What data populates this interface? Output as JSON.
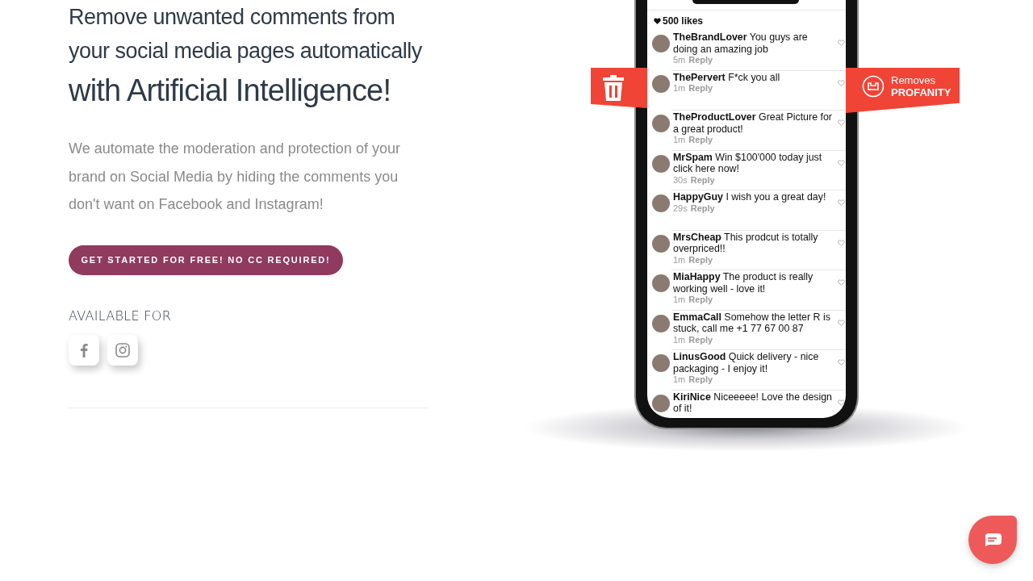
{
  "hero": {
    "heading_lines": [
      "Remove unwanted comments from",
      "your social media pages automatically"
    ],
    "heading_emphasis": "with Artificial Intelligence!",
    "description": "We automate the moderation and protection of your brand on Social Media by hiding the comments you don't want on Facebook and Instagram!",
    "cta_button": "GET STARTED FOR FREE! NO CC REQUIRED!",
    "available_label": "AVAILABLE FOR",
    "platforms": [
      {
        "kind": "facebook"
      },
      {
        "kind": "instagram"
      }
    ]
  },
  "phone": {
    "likes": "500 likes",
    "comments": [
      {
        "user": "TheBrandLover",
        "text": "You guys are doing an amazing job",
        "time": "5m",
        "reply": "Reply"
      },
      {
        "user": "ThePervert",
        "text": "F*ck you all",
        "time": "1m",
        "reply": "Reply"
      },
      {
        "user": "TheProductLover",
        "text": "Great Picture for a great product!",
        "time": "1m",
        "reply": "Reply"
      },
      {
        "user": "MrSpam",
        "text": "Win $100'000 today just click here now!",
        "time": "30s",
        "reply": "Reply"
      },
      {
        "user": "HappyGuy",
        "text": "I wish you a great day!",
        "time": "29s",
        "reply": "Reply"
      },
      {
        "user": "MrsCheap",
        "text": "This prodcut is totally overpriced!!",
        "time": "1m",
        "reply": "Reply"
      },
      {
        "user": "MiaHappy",
        "text": "The product is really working well - love it!",
        "time": "1m",
        "reply": "Reply"
      },
      {
        "user": "EmmaCall",
        "text": "Somehow the letter R is stuck, call me +1 77 67 00 87",
        "time": "1m",
        "reply": "Reply"
      },
      {
        "user": "LinusGood",
        "text": "Quick delivery - nice packaging - I enjoy it!",
        "time": "1m",
        "reply": "Reply"
      },
      {
        "user": "KiriNice",
        "text": "Niceeeee! Love the design of it!"
      }
    ]
  },
  "ribbons": [
    {
      "kind": "delete"
    },
    {
      "kind": "profanity",
      "lines": [
        "Removes",
        "PROFANITY"
      ]
    }
  ],
  "chat_widget": {
    "kind": "chat"
  }
}
